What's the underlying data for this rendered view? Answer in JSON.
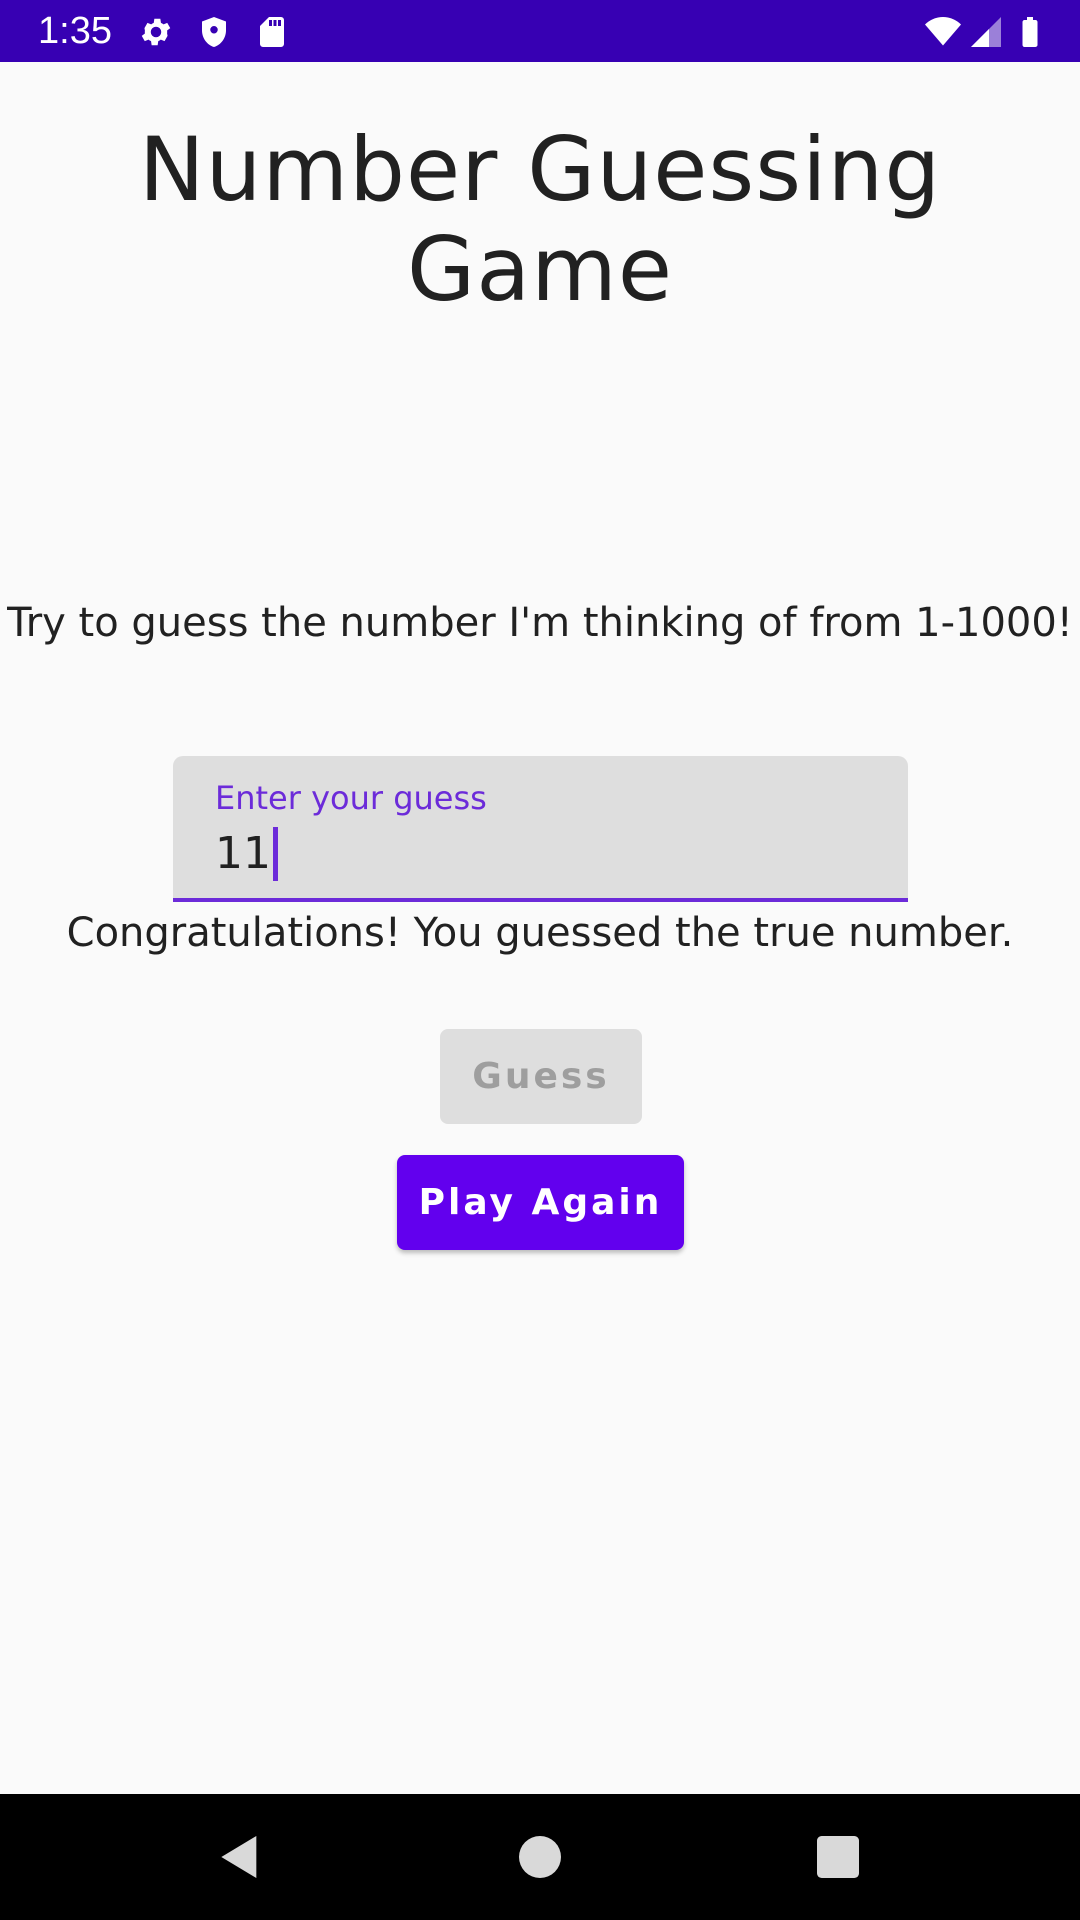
{
  "status_bar": {
    "time": "1:35",
    "left_icons": [
      "gear-icon",
      "shield-icon",
      "sd-card-icon"
    ],
    "right_icons": [
      "wifi-icon",
      "signal-icon",
      "battery-icon"
    ],
    "background_color": "#3700b3"
  },
  "app": {
    "title": "Number Guessing Game",
    "instructions": "Try to guess the number I'm thinking of from 1-1000!",
    "guess_field": {
      "label": "Enter your guess",
      "value": "11"
    },
    "result_message": "Congratulations! You guessed the true number.",
    "guess_button": {
      "label": "Guess",
      "enabled": false
    },
    "play_again_button": {
      "label": "Play Again",
      "enabled": true
    },
    "colors": {
      "accent": "#6200ee",
      "field_accent": "#6c2bd9",
      "disabled_bg": "#dedede",
      "disabled_text": "#9e9e9e"
    }
  },
  "nav_bar": {
    "buttons": [
      "back-icon",
      "home-icon",
      "recents-icon"
    ]
  }
}
